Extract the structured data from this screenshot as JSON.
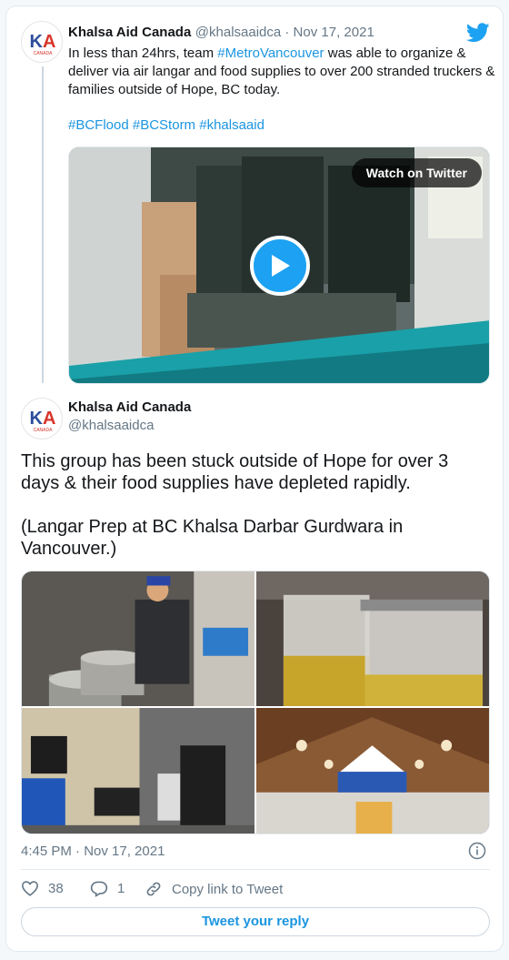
{
  "tweet": {
    "author_name": "Khalsa Aid Canada",
    "handle_date": "@khalsaaidca · Nov 17, 2021",
    "text_before": "In less than 24hrs, team ",
    "mention": "#MetroVancouver",
    "text_after": " was able to organize & deliver via air langar and food supplies to over 200 stranded truckers & families outside of Hope, BC today.",
    "hashtags": "#BCFlood #BCStorm #khalsaaid",
    "watch_label": "Watch on Twitter"
  },
  "quoted": {
    "author_name": "Khalsa Aid Canada",
    "handle": "@khalsaaidca",
    "text1": "This group has been stuck outside of Hope for over 3 days & their food supplies have depleted rapidly.",
    "text2": "(Langar Prep at BC Khalsa Darbar Gurdwara in Vancouver.)",
    "timestamp": "4:45 PM · Nov 17, 2021"
  },
  "actions": {
    "likes": "38",
    "replies": "1",
    "copy_link": "Copy link to Tweet",
    "reply_button": "Tweet your reply"
  },
  "avatar": {
    "letters": "KA",
    "subtext": "CANADA"
  },
  "colors": {
    "twitter_blue": "#1da1f2",
    "link": "#1b95e0",
    "avatar_red": "#d8352a",
    "avatar_blue": "#2b4e9b"
  }
}
